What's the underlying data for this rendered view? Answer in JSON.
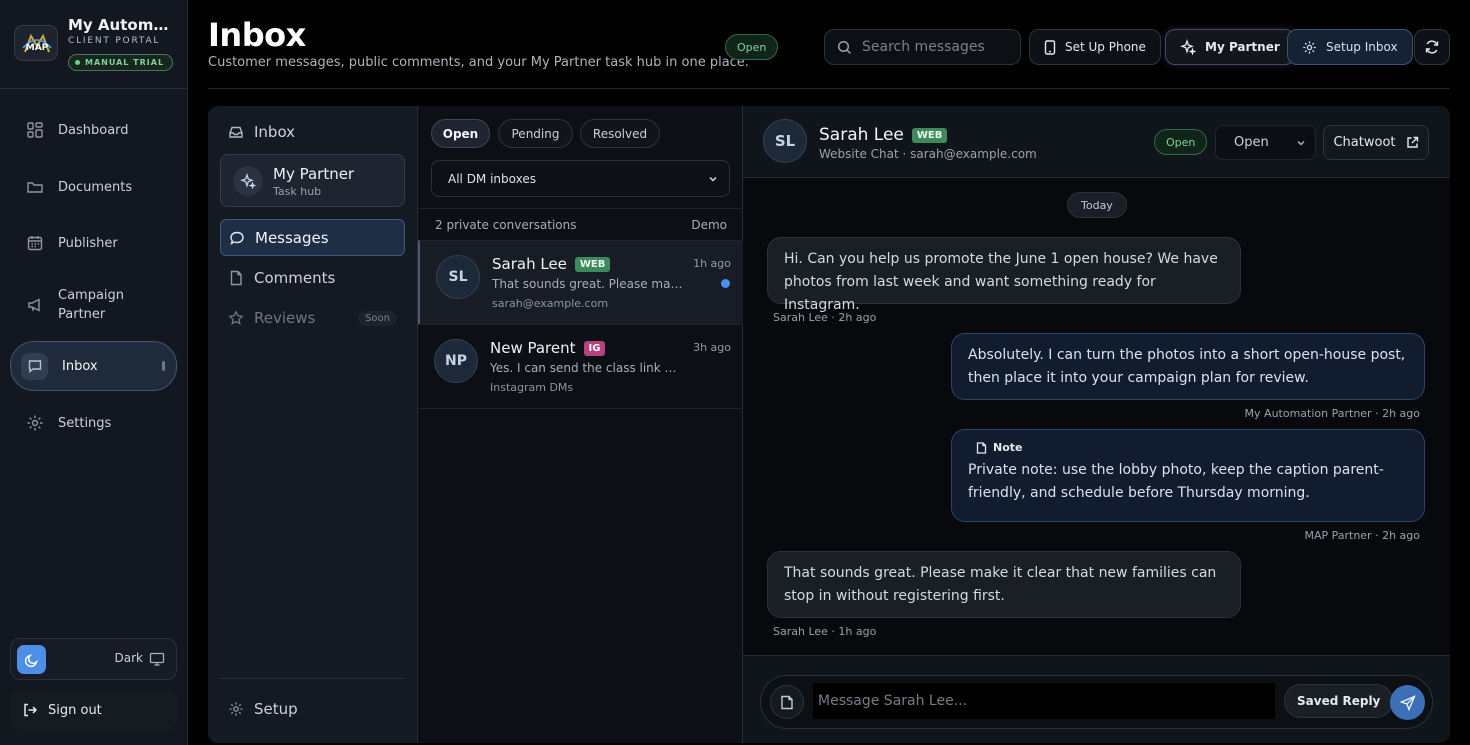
{
  "brand": {
    "title": "My Automation Partner",
    "subtitle": "CLIENT PORTAL",
    "trial": "MANUAL TRIAL",
    "logo_text": "MAP"
  },
  "nav": [
    {
      "label": "Dashboard",
      "icon": "grid-icon"
    },
    {
      "label": "Documents",
      "icon": "folder-icon"
    },
    {
      "label": "Publisher",
      "icon": "calendar-icon"
    },
    {
      "label": "Campaign Partner",
      "icon": "megaphone-icon"
    },
    {
      "label": "Inbox",
      "icon": "chat-icon"
    },
    {
      "label": "Settings",
      "icon": "gear-icon"
    }
  ],
  "theme": {
    "label": "Dark"
  },
  "sign_out": "Sign out",
  "header": {
    "title": "Inbox",
    "subtitle": "Customer messages, public comments, and your My Partner task hub in one place.",
    "status": "Open",
    "search_placeholder": "Search messages",
    "buttons": {
      "phone": "Set Up Phone",
      "partner": "My Partner",
      "setup": "Setup Inbox"
    }
  },
  "subnav": {
    "inbox": "Inbox",
    "partner_title": "My Partner",
    "partner_sub": "Task hub",
    "messages": "Messages",
    "comments": "Comments",
    "reviews": "Reviews",
    "soon": "Soon",
    "setup": "Setup"
  },
  "list": {
    "tabs": [
      "Open",
      "Pending",
      "Resolved"
    ],
    "filter": "All DM inboxes",
    "count": "2 private conversations",
    "mode": "Demo",
    "conversations": [
      {
        "initials": "SL",
        "name": "Sarah Lee",
        "channel": "WEB",
        "time": "1h ago",
        "preview": "That sounds great. Please make it clear that new families can stop in without registering first.",
        "source": "sarah@example.com",
        "unread": true
      },
      {
        "initials": "NP",
        "name": "New Parent",
        "channel": "IG",
        "time": "3h ago",
        "preview": "Yes. I can send the class link and details.",
        "source": "Instagram DMs",
        "unread": false
      }
    ]
  },
  "chat": {
    "initials": "SL",
    "name": "Sarah Lee",
    "channel": "WEB",
    "meta": "Website Chat · sarah@example.com",
    "status": "Open",
    "status_select": "Open",
    "chatwoot": "Chatwoot",
    "day": "Today",
    "messages": [
      {
        "text": "Hi. Can you help us promote the June 1 open house? We have photos from last week and want something ready for Instagram.",
        "meta": "Sarah Lee · 2h ago"
      },
      {
        "text": "Absolutely. I can turn the photos into a short open-house post, then place it into your campaign plan for review.",
        "meta": "My Automation Partner · 2h ago"
      },
      {
        "note_label": "Note",
        "text": "Private note: use the lobby photo, keep the caption parent-friendly, and schedule before Thursday morning.",
        "meta": "MAP Partner · 2h ago"
      },
      {
        "text": "That sounds great. Please make it clear that new families can stop in without registering first.",
        "meta": "Sarah Lee · 1h ago"
      }
    ],
    "composer_placeholder": "Message Sarah Lee...",
    "saved_reply": "Saved Reply"
  },
  "colors": {
    "accent": "#4a8ef0",
    "open_green": "#7fd19a",
    "web_chip": "#3f8a5c",
    "ig_chip": "#b9407e"
  }
}
